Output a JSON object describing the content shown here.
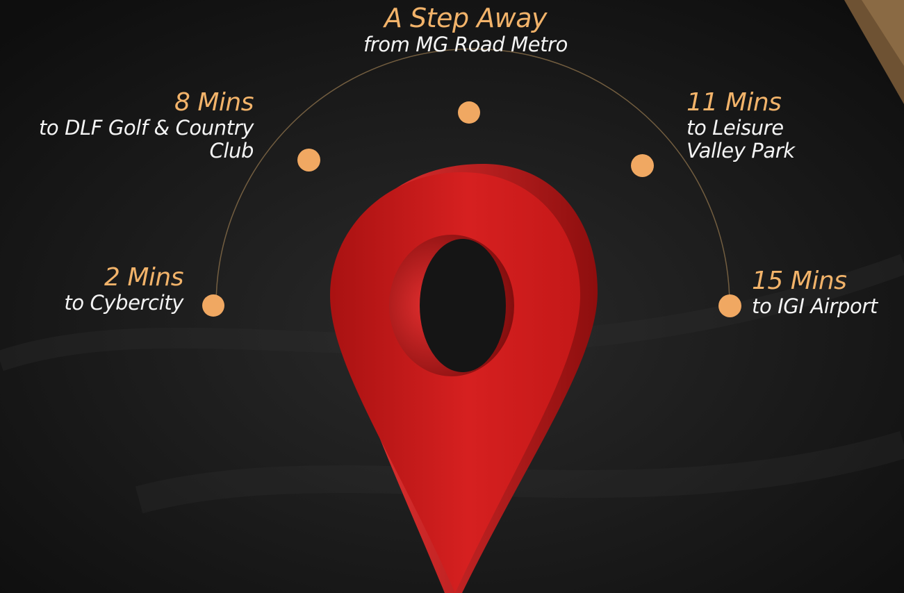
{
  "colors": {
    "accent": "#f2b36a",
    "dot": "#f0a862",
    "pin": "#d81e1e",
    "background": "#141414",
    "text": "#f4f4f4",
    "gold_corner": "#7a5c38"
  },
  "locations": [
    {
      "id": "cybercity",
      "time": "2 Mins",
      "desc_lines": [
        "to Cybercity"
      ]
    },
    {
      "id": "dlf-golf",
      "time": "8 Mins",
      "desc_lines": [
        "to DLF Golf & Country",
        "Club"
      ]
    },
    {
      "id": "mg-road-metro",
      "time": "A Step Away",
      "desc_lines": [
        "from MG Road Metro"
      ]
    },
    {
      "id": "leisure-valley",
      "time": "11 Mins",
      "desc_lines": [
        "to Leisure",
        "Valley Park"
      ]
    },
    {
      "id": "igi-airport",
      "time": "15 Mins",
      "desc_lines": [
        "to IGI Airport"
      ]
    }
  ],
  "icons": {
    "pin": "location-pin-icon"
  }
}
